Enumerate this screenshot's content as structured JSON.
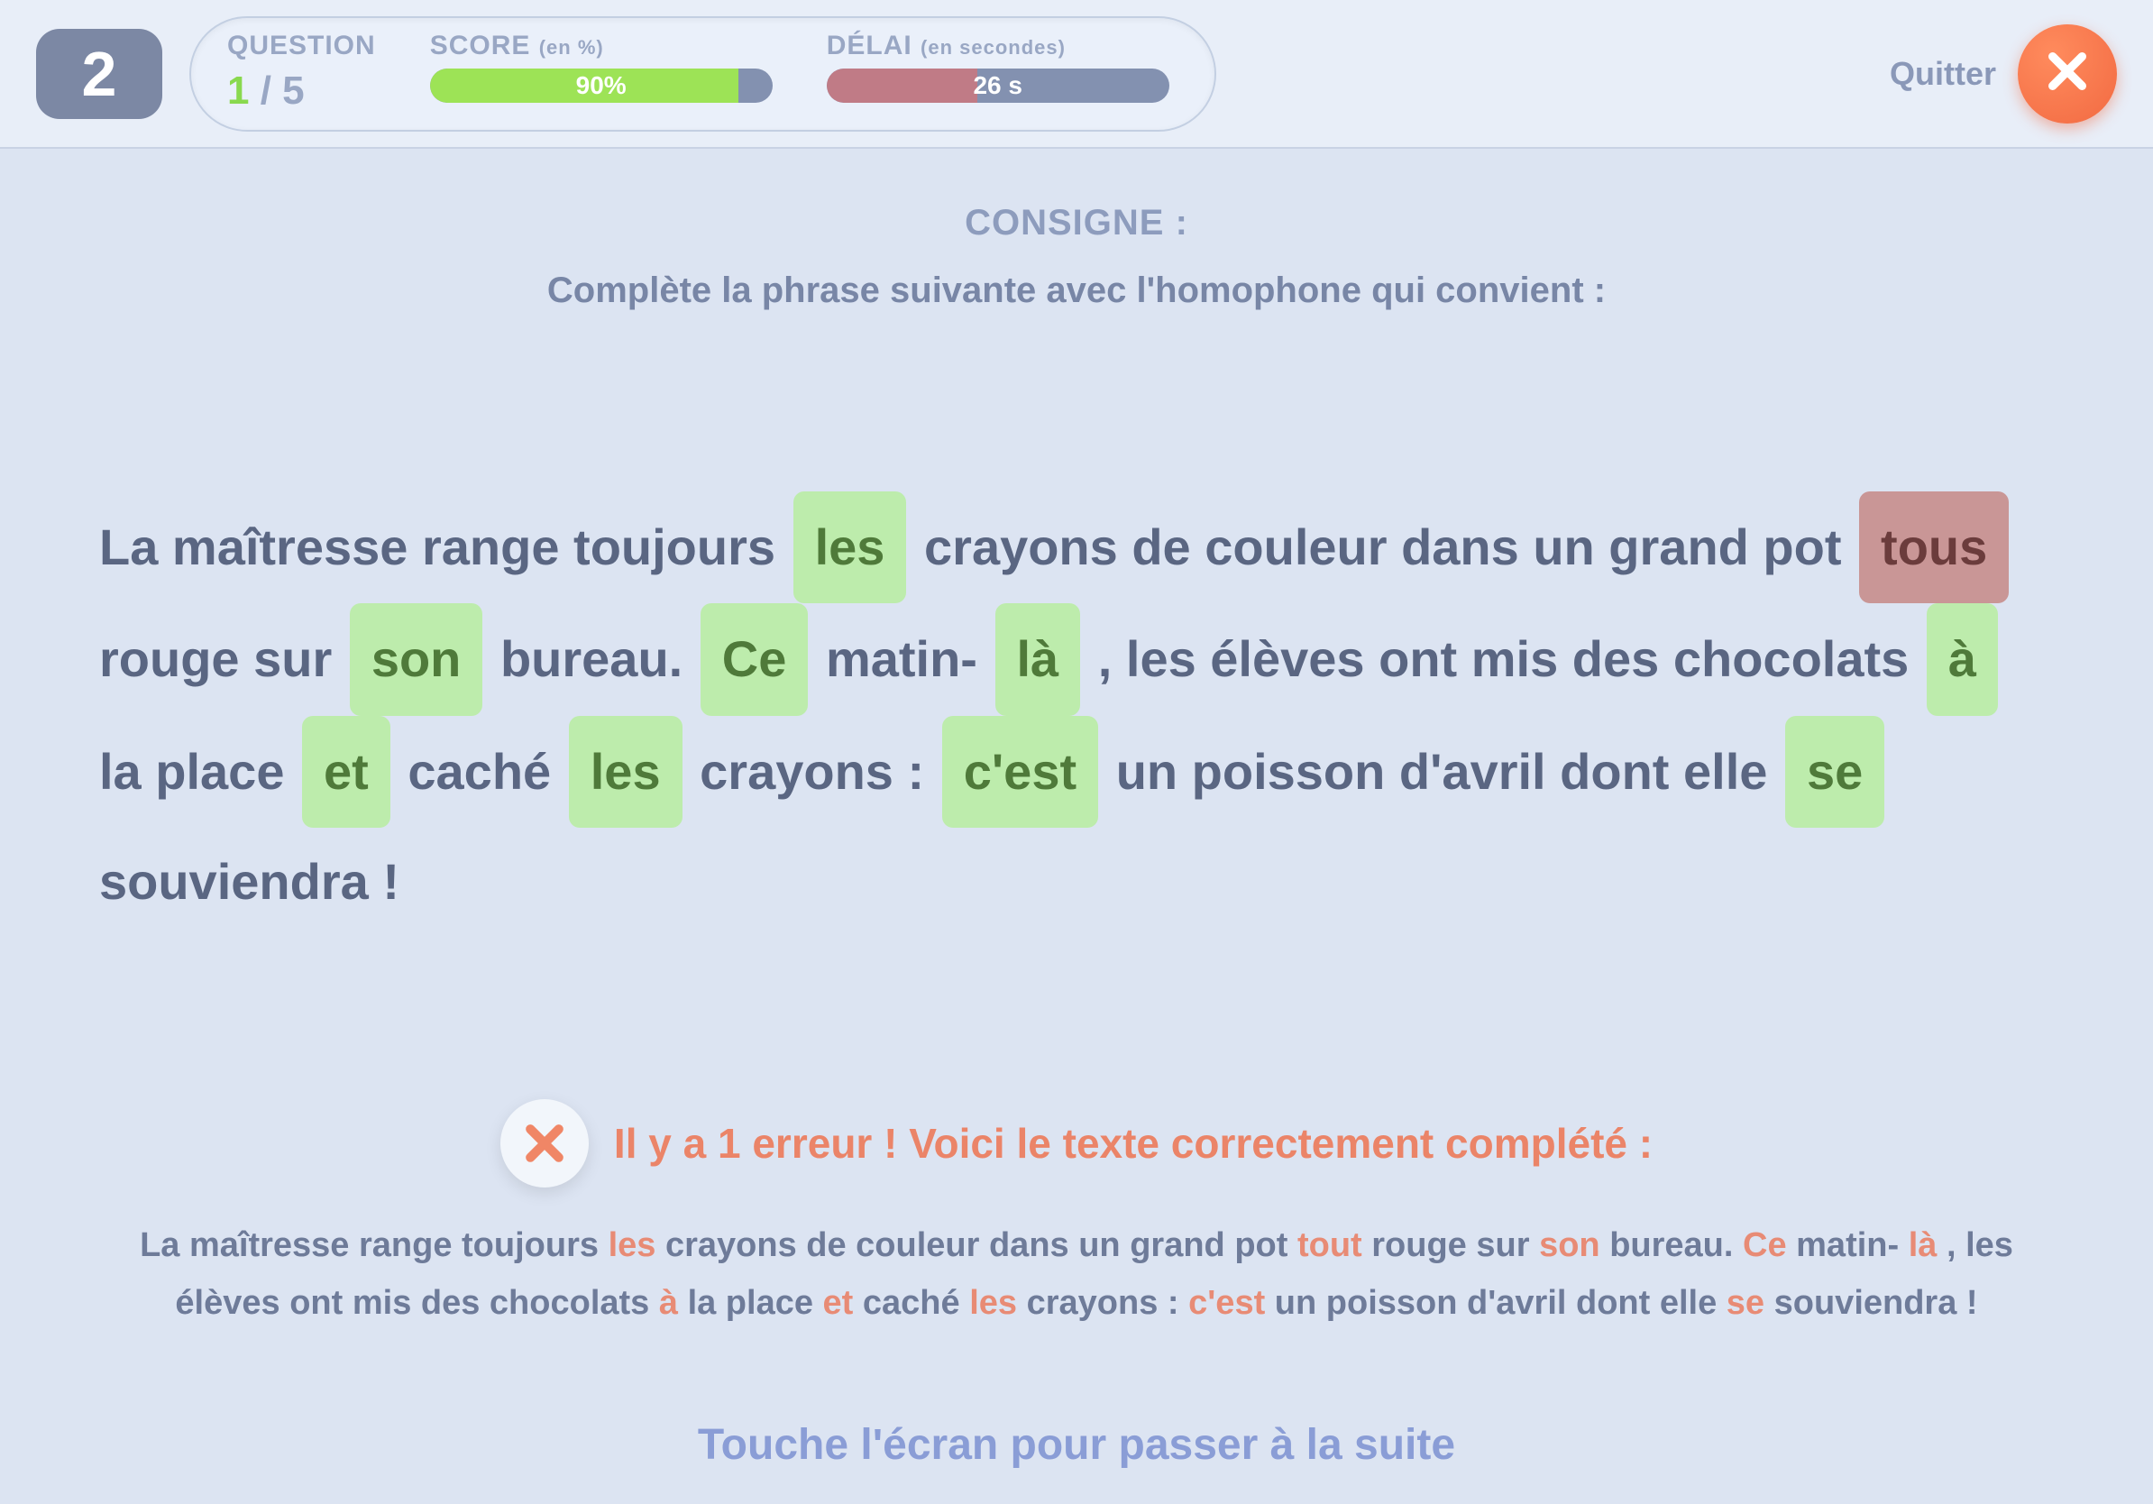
{
  "header": {
    "question_number": "2",
    "question_label": "QUESTION",
    "question_current": "1",
    "question_sep": " / ",
    "question_total": "5",
    "score_label": "SCORE",
    "score_suffix": "(en %)",
    "score_text": "90%",
    "score_pct": 90,
    "delay_label": "DÉLAI",
    "delay_suffix": "(en secondes)",
    "delay_text": "26 s",
    "delay_pct": 44,
    "quit_label": "Quitter"
  },
  "consigne": {
    "heading": "CONSIGNE :",
    "instruction": "Complète la phrase suivante avec l'homophone qui convient :"
  },
  "sentence_parts": {
    "p0": "La maîtresse range toujours ",
    "b0": "les",
    "p1": " crayons de couleur dans un grand pot ",
    "b1": "tous",
    "p2": " rouge sur ",
    "b2": "son",
    "p3": " bureau. ",
    "b3": "Ce",
    "p4": " matin- ",
    "b4": "là",
    "p5": " , les élèves ont mis des chocolats ",
    "b5": "à",
    "p6": " la place ",
    "b6": "et",
    "p7": " caché ",
    "b7": "les",
    "p8": " crayons : ",
    "b8": "c'est",
    "p9": " un poisson d'avril dont elle ",
    "b9": "se",
    "p10": " souviendra !"
  },
  "feedback": {
    "message": "Il y a 1 erreur ! Voici le texte correctement complété :"
  },
  "solution_parts": {
    "s0": "La maîtresse range toujours ",
    "h0": "les",
    "s1": " crayons de couleur dans un grand pot ",
    "h1": "tout",
    "s2": " rouge sur ",
    "h2": "son",
    "s3": " bureau. ",
    "h3": "Ce",
    "s4": " matin- ",
    "h4": "là",
    "s5": ", les élèves ont mis des chocolats ",
    "h5": "à",
    "s6": " la place ",
    "h6": "et",
    "s7": " caché ",
    "h7": "les",
    "s8": " crayons : ",
    "h8": "c'est",
    "s9": " un poisson d'avril dont elle ",
    "h9": "se",
    "s10": " souviendra !"
  },
  "footer": {
    "tap_prompt": "Touche l'écran pour passer à la suite"
  },
  "colors": {
    "accent_orange": "#f26a42",
    "accent_green": "#9de356"
  }
}
